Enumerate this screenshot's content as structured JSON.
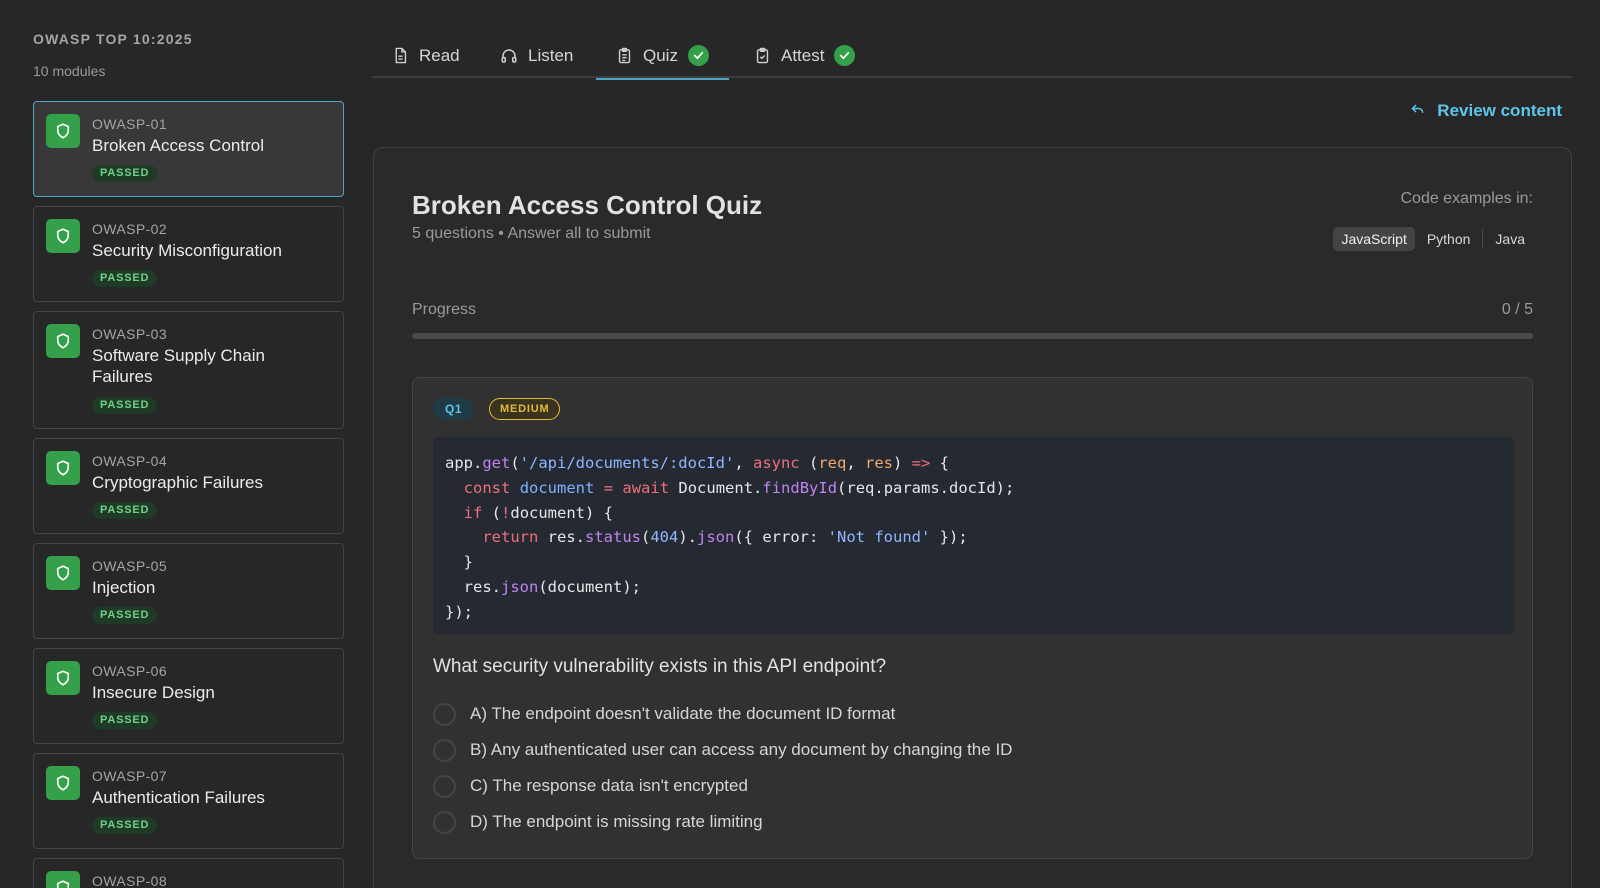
{
  "sidebar": {
    "title": "OWASP TOP 10:2025",
    "subtitle": "10 modules",
    "modules": [
      {
        "code": "OWASP-01",
        "name": "Broken Access Control",
        "status": "PASSED"
      },
      {
        "code": "OWASP-02",
        "name": "Security Misconfiguration",
        "status": "PASSED"
      },
      {
        "code": "OWASP-03",
        "name": "Software Supply Chain Failures",
        "status": "PASSED"
      },
      {
        "code": "OWASP-04",
        "name": "Cryptographic Failures",
        "status": "PASSED"
      },
      {
        "code": "OWASP-05",
        "name": "Injection",
        "status": "PASSED"
      },
      {
        "code": "OWASP-06",
        "name": "Insecure Design",
        "status": "PASSED"
      },
      {
        "code": "OWASP-07",
        "name": "Authentication Failures",
        "status": "PASSED"
      },
      {
        "code": "OWASP-08",
        "name": "",
        "status": ""
      }
    ]
  },
  "tabs": {
    "read": "Read",
    "listen": "Listen",
    "quiz": "Quiz",
    "attest": "Attest"
  },
  "review_link": "Review content",
  "quiz": {
    "title": "Broken Access Control Quiz",
    "meta": "5 questions • Answer all to submit",
    "code_examples_label": "Code examples in:",
    "languages": [
      "JavaScript",
      "Python",
      "Java"
    ],
    "selected_language": "JavaScript",
    "progress_label": "Progress",
    "progress_count": "0 / 5",
    "progress_fraction": 0
  },
  "question": {
    "number": "Q1",
    "difficulty": "MEDIUM",
    "text": "What security vulnerability exists in this API endpoint?",
    "options": [
      "A) The endpoint doesn't validate the document ID format",
      "B) Any authenticated user can access any document by changing the ID",
      "C) The response data isn't encrypted",
      "D) The endpoint is missing rate limiting"
    ],
    "code": [
      "app.get('/api/documents/:docId', async (req, res) => {",
      "  const document = await Document.findById(req.params.docId);",
      "  if (!document) {",
      "    return res.status(404).json({ error: 'Not found' });",
      "  }",
      "  res.json(document);",
      "});"
    ]
  },
  "colors": {
    "accent": "#5cc6ea",
    "success": "#35a04a",
    "warning": "#e3bb3a",
    "background": "#272727"
  }
}
